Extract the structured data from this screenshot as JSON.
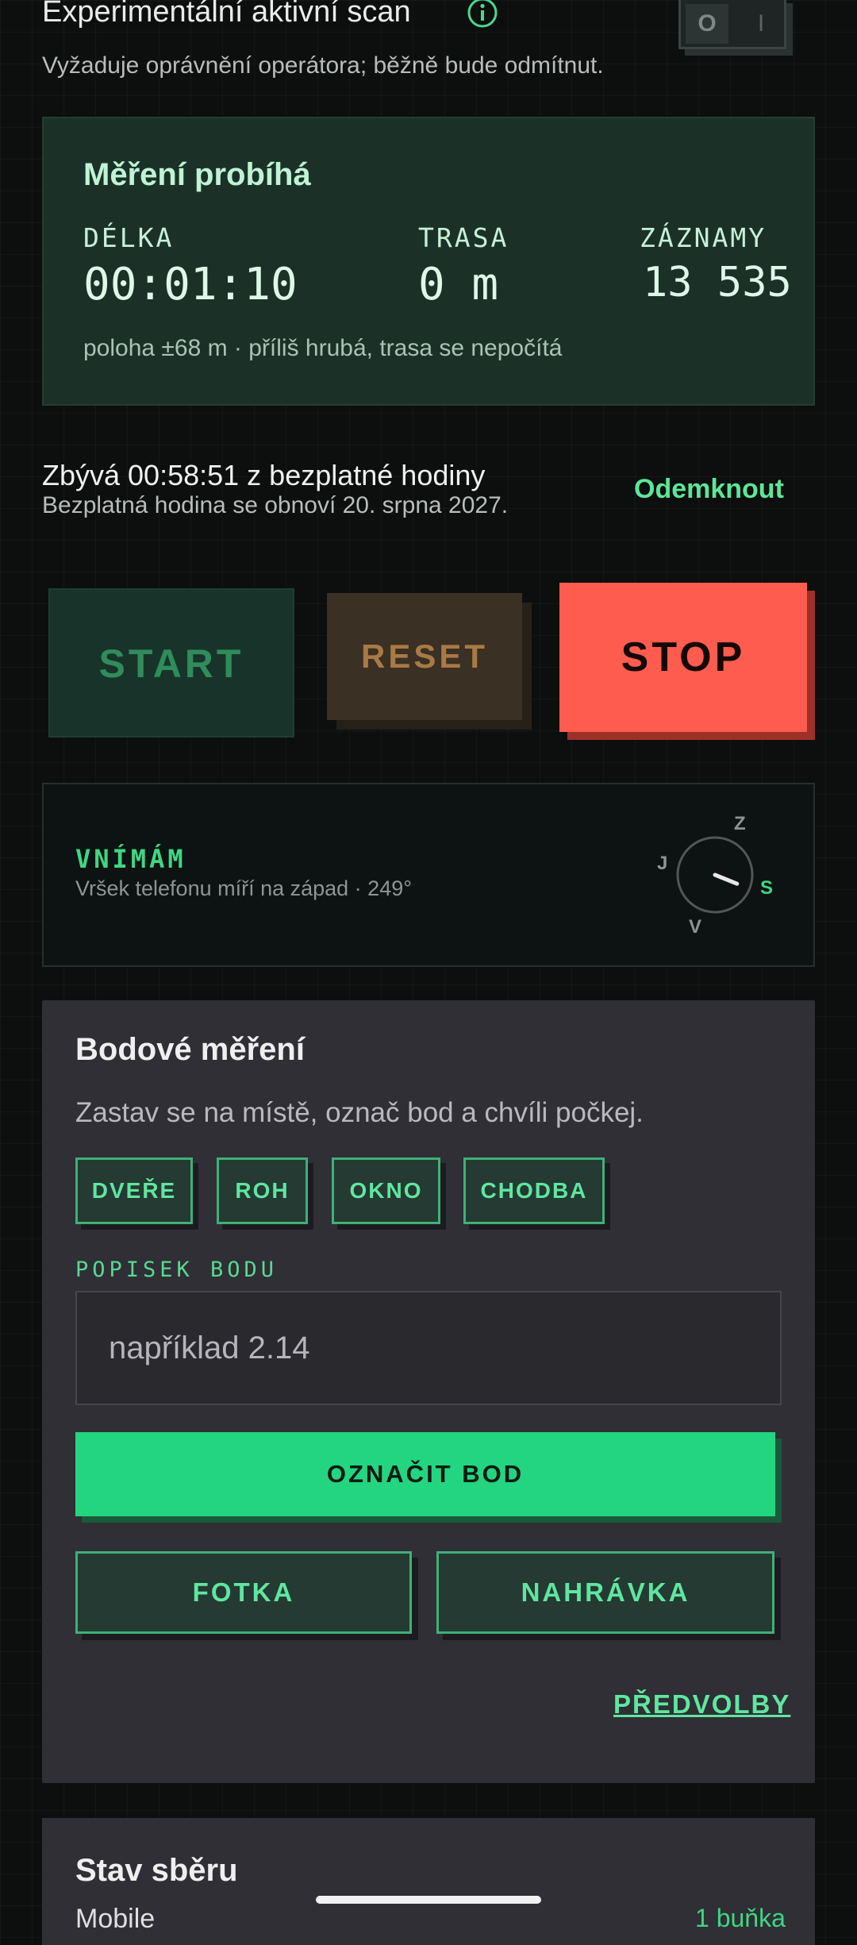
{
  "experimental": {
    "title": "Experimentální aktivní scan",
    "subtitle": "Vyžaduje oprávnění operátora; běžně bude odmítnut.",
    "toggle_off": "O",
    "toggle_on": "I"
  },
  "measurement": {
    "title": "Měření probíhá",
    "duration_label": "DÉLKA",
    "duration_value": "00:01:10",
    "route_label": "TRASA",
    "route_value": "0 m",
    "records_label": "ZÁZNAMY",
    "records_value": "13 535",
    "note": "poloha ±68 m · příliš hrubá, trasa se nepočítá"
  },
  "free_hour": {
    "remaining": "Zbývá 00:58:51 z bezplatné hodiny",
    "renewal": "Bezplatná hodina se obnoví 20. srpna 2027.",
    "unlock": "Odemknout"
  },
  "controls": {
    "start": "START",
    "reset": "RESET",
    "stop": "STOP"
  },
  "sensing": {
    "label": "VNÍMÁM",
    "detail": "Vršek telefonu míří na západ · 249°",
    "compass_n": "Z",
    "compass_e": "S",
    "compass_s": "V",
    "compass_w": "J",
    "heading_deg": 249
  },
  "point_measurement": {
    "title": "Bodové měření",
    "help": "Zastav se na místě, označ bod a chvíli počkej.",
    "chips": [
      "DVEŘE",
      "ROH",
      "OKNO",
      "CHODBA"
    ],
    "label_caption": "POPISEK BODU",
    "label_placeholder": "například 2.14",
    "mark_button": "OZNAČIT BOD",
    "photo_button": "FOTKA",
    "recording_button": "NAHRÁVKA",
    "presets_link": "PŘEDVOLBY"
  },
  "collection_status": {
    "title": "Stav sběru",
    "mobile_label": "Mobile",
    "mobile_value": "1 buňka"
  },
  "colors": {
    "accent_green": "#23d580",
    "stop_red": "#fe5c4e",
    "background": "#0c0f0e"
  }
}
